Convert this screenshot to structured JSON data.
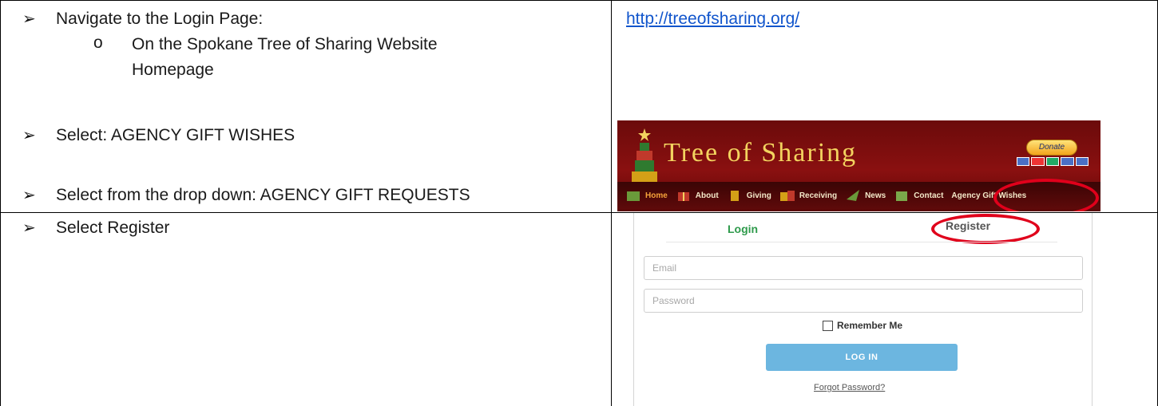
{
  "rows": [
    {
      "left": {
        "bullets": [
          {
            "text": "Navigate to the Login Page:"
          },
          {
            "sub": "On the Spokane Tree of Sharing Website",
            "sub2": "Homepage"
          },
          {
            "text": "Select: AGENCY GIFT WISHES"
          },
          {
            "text": "Select from the drop down: AGENCY GIFT REQUESTS"
          }
        ]
      },
      "right": {
        "link": "http://treeofsharing.org/"
      }
    },
    {
      "left": {
        "bullets": [
          {
            "text": "Select Register"
          }
        ]
      }
    }
  ],
  "banner": {
    "title": "Tree of Sharing",
    "donate_label": "Donate",
    "nav": [
      "Home",
      "About",
      "Giving",
      "Receiving",
      "News",
      "Contact",
      "Agency Gift Wishes"
    ],
    "highlight_color": "#e0001b"
  },
  "login": {
    "tab_login": "Login",
    "tab_register": "Register",
    "email_placeholder": "Email",
    "password_placeholder": "Password",
    "remember_label": "Remember Me",
    "login_button": "LOG IN",
    "forgot_link": "Forgot Password?",
    "login_tab_color": "#2e9a4b"
  },
  "bullet_glyph": "➢",
  "sub_glyph": "o"
}
